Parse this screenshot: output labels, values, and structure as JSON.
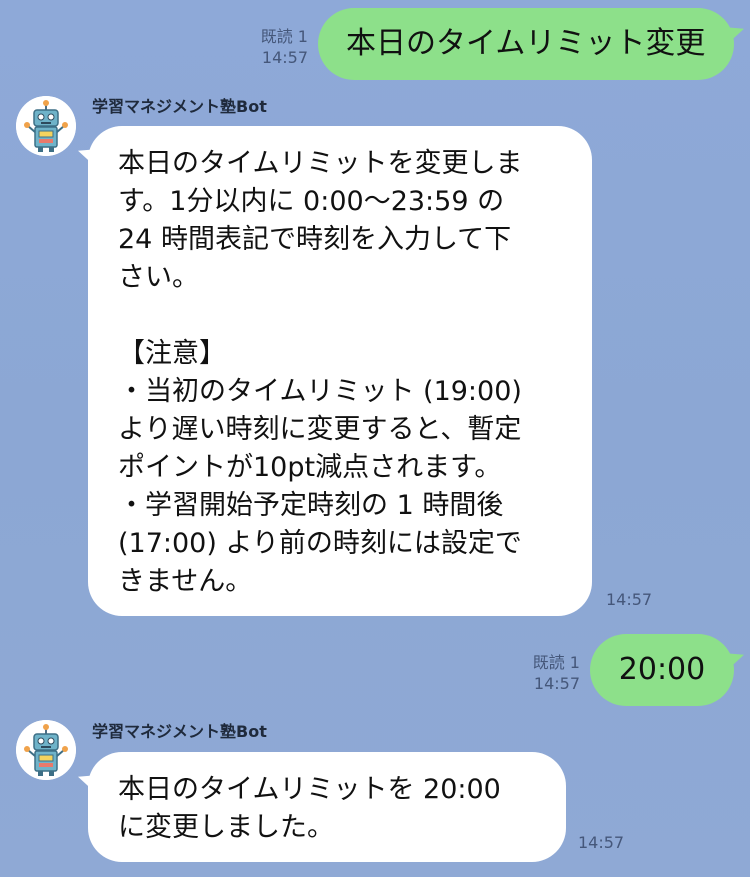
{
  "colors": {
    "background": "#8da8d6",
    "outgoing_bubble": "#8de08a",
    "incoming_bubble": "#ffffff",
    "meta_text": "#45577a"
  },
  "messages": [
    {
      "direction": "outgoing",
      "text": "本日のタイムリミット変更",
      "read_label": "既読 1",
      "time": "14:57"
    },
    {
      "direction": "incoming",
      "sender": "学習マネジメント塾Bot",
      "avatar_icon": "robot-avatar-icon",
      "lines": [
        "本日のタイムリミットを変更しま",
        "す。1分以内に 0:00〜23:59 の",
        "24 時間表記で時刻を入力して下",
        "さい。",
        "",
        "【注意】",
        "・当初のタイムリミット (19:00)",
        "より遅い時刻に変更すると、暫定",
        "ポイントが10pt減点されます。",
        "・学習開始予定時刻の 1 時間後",
        "(17:00) より前の時刻には設定で",
        "きません。"
      ],
      "time": "14:57"
    },
    {
      "direction": "outgoing",
      "text": "20:00",
      "read_label": "既読 1",
      "time": "14:57"
    },
    {
      "direction": "incoming",
      "sender": "学習マネジメント塾Bot",
      "avatar_icon": "robot-avatar-icon",
      "lines": [
        "本日のタイムリミットを 20:00",
        "に変更しました。"
      ],
      "time": "14:57"
    }
  ]
}
